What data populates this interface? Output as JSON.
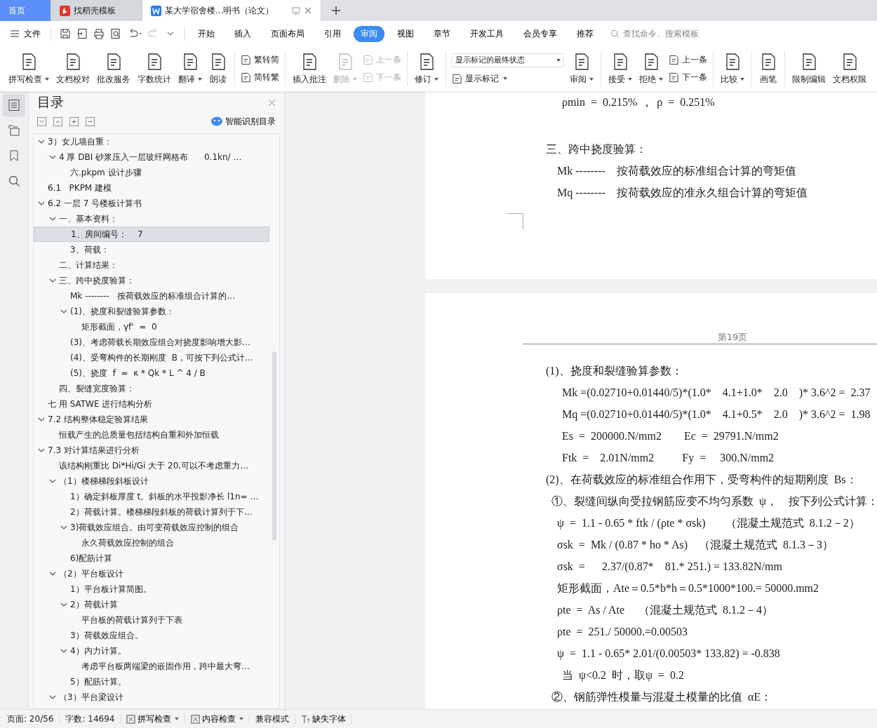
{
  "tabs": [
    {
      "label": "首页",
      "kind": "home",
      "selected": false
    },
    {
      "label": "找稻壳模板",
      "kind": "docer",
      "selected": false
    },
    {
      "label": "某大学宿舍楼...明书（论文）",
      "kind": "doc",
      "selected": true
    }
  ],
  "file_menu": "文件",
  "menu": [
    {
      "label": "开始",
      "selected": false
    },
    {
      "label": "插入",
      "selected": false
    },
    {
      "label": "页面布局",
      "selected": false
    },
    {
      "label": "引用",
      "selected": false
    },
    {
      "label": "审阅",
      "selected": true
    },
    {
      "label": "视图",
      "selected": false
    },
    {
      "label": "章节",
      "selected": false
    },
    {
      "label": "开发工具",
      "selected": false
    },
    {
      "label": "会员专享",
      "selected": false
    },
    {
      "label": "推荐",
      "selected": false
    }
  ],
  "search": {
    "placeholder": "查找命令、搜索模板"
  },
  "ribbon": [
    {
      "items": [
        {
          "kind": "large",
          "label": "拼写检查",
          "dropdown": true,
          "disabled": false
        },
        {
          "kind": "large",
          "label": "文档校对",
          "dropdown": false,
          "disabled": false
        },
        {
          "kind": "large",
          "label": "批改服务",
          "dropdown": false,
          "disabled": false
        },
        {
          "kind": "large",
          "label": "字数统计",
          "dropdown": false,
          "disabled": false
        },
        {
          "kind": "large",
          "label": "翻译",
          "dropdown": true,
          "disabled": false
        },
        {
          "kind": "large",
          "label": "朗读",
          "dropdown": false,
          "disabled": false
        }
      ]
    },
    {
      "items": [
        {
          "kind": "stack",
          "items": [
            {
              "kind": "small",
              "label": "繁转简",
              "dropdown": false,
              "disabled": false
            },
            {
              "kind": "small",
              "label": "简转繁",
              "dropdown": false,
              "disabled": false
            }
          ]
        }
      ]
    },
    {
      "items": [
        {
          "kind": "large",
          "label": "插入批注",
          "dropdown": false,
          "disabled": false
        },
        {
          "kind": "large",
          "label": "删除",
          "dropdown": true,
          "disabled": true
        },
        {
          "kind": "stack",
          "items": [
            {
              "kind": "small",
              "label": "上一条",
              "dropdown": false,
              "disabled": true
            },
            {
              "kind": "small",
              "label": "下一条",
              "dropdown": false,
              "disabled": true
            }
          ]
        }
      ]
    },
    {
      "items": [
        {
          "kind": "large",
          "label": "修订",
          "dropdown": true,
          "disabled": false
        }
      ]
    },
    {
      "items": [
        {
          "kind": "stack",
          "items": [
            {
              "kind": "select",
              "label": "显示标记的最终状态",
              "dropdown": true,
              "disabled": false
            },
            {
              "kind": "small",
              "label": "显示标记",
              "dropdown": true,
              "disabled": false
            }
          ]
        },
        {
          "kind": "large",
          "label": "审阅",
          "dropdown": true,
          "disabled": false
        }
      ]
    },
    {
      "items": [
        {
          "kind": "large",
          "label": "接受",
          "dropdown": true,
          "disabled": false
        },
        {
          "kind": "large",
          "label": "拒绝",
          "dropdown": true,
          "disabled": false
        },
        {
          "kind": "stack",
          "items": [
            {
              "kind": "small",
              "label": "上一条",
              "dropdown": false,
              "disabled": false
            },
            {
              "kind": "small",
              "label": "下一条",
              "dropdown": false,
              "disabled": false
            }
          ]
        }
      ]
    },
    {
      "items": [
        {
          "kind": "large",
          "label": "比较",
          "dropdown": true,
          "disabled": false
        }
      ]
    },
    {
      "items": [
        {
          "kind": "large",
          "label": "画笔",
          "dropdown": false,
          "disabled": false
        }
      ]
    },
    {
      "items": [
        {
          "kind": "large",
          "label": "限制编辑",
          "dropdown": false,
          "disabled": false
        },
        {
          "kind": "large",
          "label": "文档权限",
          "dropdown": false,
          "disabled": false
        }
      ]
    }
  ],
  "rail": [
    {
      "selected": true
    },
    {
      "selected": false
    },
    {
      "selected": false
    },
    {
      "selected": false
    }
  ],
  "outline": {
    "title": "目录",
    "smart": "智能识别目录",
    "items": [
      {
        "label": "3）女儿墙自重：",
        "selected": false,
        "expanded": true,
        "children": [
          {
            "label": "4 厚 DBI 砂浆压入一层玻纤网格布      0.1kn/ …",
            "selected": false,
            "expanded": true,
            "children": [
              {
                "label": "六.pkpm 设计步骤",
                "selected": false
              }
            ]
          }
        ]
      },
      {
        "label": "6.1   PKPM 建模",
        "selected": false
      },
      {
        "label": "6.2 一层 7 号楼板计算书",
        "selected": false,
        "expanded": true,
        "children": [
          {
            "label": "一、基本资料：",
            "selected": false,
            "expanded": true,
            "children": [
              {
                "label": "1、房间编号：    7",
                "selected": true
              },
              {
                "label": "3、荷载：",
                "selected": false
              }
            ]
          },
          {
            "label": "二、计算结果：",
            "selected": false
          },
          {
            "label": "三、跨中挠度验算：",
            "selected": false,
            "expanded": true,
            "children": [
              {
                "label": "Mk --------   按荷载效应的标准组合计算的…",
                "selected": false
              },
              {
                "label": "(1)、挠度和裂缝验算参数：",
                "selected": false,
                "expanded": true,
                "children": [
                  {
                    "label": "矩形截面，γf'  =  0",
                    "selected": false
                  }
                ]
              },
              {
                "label": "(3)、考虑荷载长期效应组合对挠度影响增大影…",
                "selected": false
              },
              {
                "label": "(4)、受弯构件的长期刚度  B，可按下列公式计…",
                "selected": false
              },
              {
                "label": "(5)、挠度  f  =  κ * Qk * L ^ 4 / B",
                "selected": false
              }
            ]
          },
          {
            "label": "四、裂缝宽度验算：",
            "selected": false
          }
        ]
      },
      {
        "label": "七 用 SATWE 进行结构分析",
        "selected": false
      },
      {
        "label": "7.2 结构整体稳定验算结果",
        "selected": false,
        "expanded": true,
        "children": [
          {
            "label": "恒载产生的总质量包括结构自重和外加恒载",
            "selected": false
          }
        ]
      },
      {
        "label": "7.3 对计算结果进行分析",
        "selected": false,
        "expanded": true,
        "children": [
          {
            "label": "该结构刚重比 Di*Hi/Gi 大于 20,可以不考虑重力…",
            "selected": false
          },
          {
            "label": "（1）楼梯梯段斜板设计",
            "selected": false,
            "expanded": true,
            "children": [
              {
                "label": "1）确定斜板厚度 t。斜板的水平投影净长 l1n= …",
                "selected": false
              },
              {
                "label": "2）荷载计算。楼梯梯段斜板的荷载计算列于下…",
                "selected": false
              },
              {
                "label": "3)荷载效应组合。由可变荷载效应控制的组合",
                "selected": false,
                "expanded": true,
                "children": [
                  {
                    "label": "永久荷载效应控制的组合",
                    "selected": false
                  }
                ]
              },
              {
                "label": "6)配筋计算",
                "selected": false
              }
            ]
          },
          {
            "label": "（2）平台板设计",
            "selected": false,
            "expanded": true,
            "children": [
              {
                "label": "1）平台板计算简图。",
                "selected": false
              },
              {
                "label": "2）荷载计算",
                "selected": false,
                "expanded": true,
                "children": [
                  {
                    "label": "平台板的荷载计算列于下表",
                    "selected": false
                  }
                ]
              },
              {
                "label": "3）荷载效应组合。",
                "selected": false
              },
              {
                "label": "4）内力计算。",
                "selected": false,
                "expanded": true,
                "children": [
                  {
                    "label": "考虑平台板两端梁的嵌固作用，跨中最大弯…",
                    "selected": false
                  }
                ]
              },
              {
                "label": "5）配筋计算。",
                "selected": false
              }
            ]
          },
          {
            "label": "（3）平台梁设计",
            "selected": false,
            "expanded": true
          }
        ]
      }
    ]
  },
  "pages": [
    {
      "lines": [
        {
          "kind": "formula",
          "text": "ρmin  =  0.215%   ,   ρ  =  0.251%"
        },
        {
          "kind": "gap",
          "text": "三、跨中挠度验算："
        },
        {
          "kind": "item",
          "text": "Mk --------    按荷载效应的标准组合计算的弯矩值"
        },
        {
          "kind": "item",
          "text": "Mq --------    按荷载效应的准永久组合计算的弯矩值"
        }
      ]
    },
    {
      "header": "第19页",
      "lines": [
        {
          "kind": "section",
          "text": "(1)、挠度和裂缝验算参数："
        },
        {
          "kind": "formula",
          "text": "Mk =(0.02710+0.01440/5)*(1.0*    4.1+1.0*    2.0    )* 3.6^2 =  2.37"
        },
        {
          "kind": "formula",
          "text": "Mq =(0.02710+0.01440/5)*(1.0*    4.1+0.5*    2.0    )* 3.6^2 =  1.98"
        },
        {
          "kind": "formula",
          "text": "Es  =  200000.N/mm2        Ec  =  29791.N/mm2"
        },
        {
          "kind": "formula",
          "text": "Ftk  =    2.01N/mm2          Fy  =     300.N/mm2"
        },
        {
          "kind": "section",
          "text": "(2)、在荷载效应的标准组合作用下，受弯构件的短期刚度  Bs："
        },
        {
          "kind": "sub",
          "text": "①、裂缝间纵向受拉钢筋应变不均匀系数  ψ，    按下列公式计算："
        },
        {
          "kind": "item",
          "text": "ψ  =  1.1 - 0.65 * ftk / (ρte * σsk)       （混凝土规范式  8.1.2－2）"
        },
        {
          "kind": "item",
          "text": "σsk  =  Mk / (0.87 * ho * As)    （混凝土规范式  8.1.3－3）"
        },
        {
          "kind": "item",
          "text": "σsk  =      2.37/(0.87*    81.* 251.) = 133.82N/mm"
        },
        {
          "kind": "item",
          "text": "矩形截面，Ate＝0.5*b*h＝0.5*1000*100.= 50000.mm2"
        },
        {
          "kind": "item",
          "text": "ρte  =  As / Ate     （混凝土规范式  8.1.2－4）"
        },
        {
          "kind": "item",
          "text": "ρte  =  251./ 50000.=0.00503"
        },
        {
          "kind": "item",
          "text": "ψ  =  1.1 - 0.65* 2.01/(0.00503* 133.82) = -0.838"
        },
        {
          "kind": "formula",
          "text": "当  ψ<0.2  时，取ψ  =  0.2"
        },
        {
          "kind": "sub",
          "text": "②、钢筋弹性模量与混凝土模量的比值  αE："
        }
      ]
    }
  ],
  "status": [
    {
      "kind": "text",
      "label": "页面: 20/56"
    },
    {
      "kind": "text",
      "label": "字数: 14694"
    },
    {
      "kind": "menu",
      "label": "拼写检查"
    },
    {
      "kind": "menu",
      "label": "内容检查"
    },
    {
      "kind": "text",
      "label": "兼容模式"
    },
    {
      "kind": "icon",
      "label": "缺失字体"
    }
  ]
}
